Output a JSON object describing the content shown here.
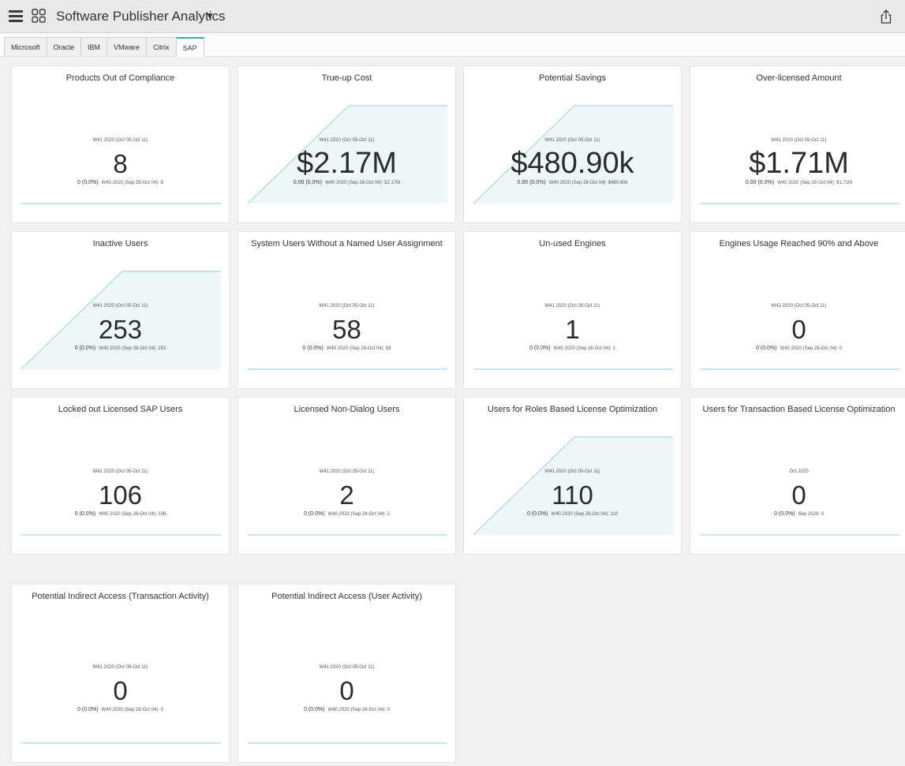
{
  "app": {
    "title": "Software Publisher Analytics"
  },
  "tabs": [
    {
      "label": "Microsoft",
      "active": false
    },
    {
      "label": "Oracle",
      "active": false
    },
    {
      "label": "IBM",
      "active": false
    },
    {
      "label": "VMware",
      "active": false
    },
    {
      "label": "Citrix",
      "active": false
    },
    {
      "label": "SAP",
      "active": true
    }
  ],
  "colors": {
    "accent": "#3aa6a1",
    "sparkline": "#a9d5ec",
    "spark_fill": "#eef7f8"
  },
  "cards": [
    {
      "title": "Products Out of Compliance",
      "period": "W41 2020 (Oct 05-Oct 11)",
      "value": "8",
      "change": "0 (0.0%)",
      "previous": "W40 2020 (Sep 28-Oct 04): 8",
      "trend": "flat"
    },
    {
      "title": "True-up Cost",
      "period": "W41 2020 (Oct 05-Oct 11)",
      "value": "$2.17M",
      "change": "0.00 (0.0%)",
      "previous": "W40 2020 (Sep 28-Oct 04): $2.17M",
      "trend": "rise"
    },
    {
      "title": "Potential Savings",
      "period": "W41 2020 (Oct 05-Oct 11)",
      "value": "$480.90k",
      "change": "0.00 (0.0%)",
      "previous": "W40 2020 (Sep 28-Oct 04): $480.90k",
      "trend": "rise"
    },
    {
      "title": "Over-licensed Amount",
      "period": "W41 2020 (Oct 05-Oct 11)",
      "value": "$1.71M",
      "change": "0.00 (0.0%)",
      "previous": "W40 2020 (Sep 28-Oct 04): $1.71M",
      "trend": "flat"
    },
    {
      "title": "Inactive Users",
      "period": "W41 2020 (Oct 05-Oct 11)",
      "value": "253",
      "change": "0 (0.0%)",
      "previous": "W40 2020 (Sep 28-Oct 04): 253",
      "trend": "rise"
    },
    {
      "title": "System Users Without a Named User Assignment",
      "period": "W41 2020 (Oct 05-Oct 11)",
      "value": "58",
      "change": "0 (0.0%)",
      "previous": "W40 2020 (Sep 28-Oct 04): 58",
      "trend": "flat"
    },
    {
      "title": "Un-used Engines",
      "period": "W41 2020 (Oct 05-Oct 11)",
      "value": "1",
      "change": "0 (0.0%)",
      "previous": "W40 2020 (Sep 28-Oct 04): 1",
      "trend": "flat"
    },
    {
      "title": "Engines Usage Reached 90% and Above",
      "period": "W41 2020 (Oct 05-Oct 11)",
      "value": "0",
      "change": "0 (0.0%)",
      "previous": "W40 2020 (Sep 28-Oct 04): 0",
      "trend": "flat"
    },
    {
      "title": "Locked out Licensed SAP Users",
      "period": "W41 2020 (Oct 05-Oct 11)",
      "value": "106",
      "change": "0 (0.0%)",
      "previous": "W40 2020 (Sep 28-Oct 04): 106",
      "trend": "flat"
    },
    {
      "title": "Licensed Non-Dialog Users",
      "period": "W41 2020 (Oct 05-Oct 11)",
      "value": "2",
      "change": "0 (0.0%)",
      "previous": "W40 2020 (Sep 28-Oct 04): 2",
      "trend": "flat"
    },
    {
      "title": "Users for Roles Based License Optimization",
      "period": "W41 2020 (Oct 05-Oct 11)",
      "value": "110",
      "change": "0 (0.0%)",
      "previous": "W40 2020 (Sep 28-Oct 04): 110",
      "trend": "rise"
    },
    {
      "title": "Users for Transaction Based License Optimization",
      "period": "Oct 2020",
      "value": "0",
      "change": "0 (0.0%)",
      "previous": "Sep 2020: 0",
      "trend": "flat"
    },
    {
      "title": "Potential Indirect Access (Transaction Activity)",
      "period": "W41 2020 (Oct 05-Oct 11)",
      "value": "0",
      "change": "0 (0.0%)",
      "previous": "W40 2020 (Sep 28-Oct 04): 0",
      "trend": "flat"
    },
    {
      "title": "Potential Indirect Access (User Activity)",
      "period": "W41 2020 (Oct 05-Oct 11)",
      "value": "0",
      "change": "0 (0.0%)",
      "previous": "W40 2020 (Sep 28-Oct 04): 0",
      "trend": "flat"
    }
  ]
}
